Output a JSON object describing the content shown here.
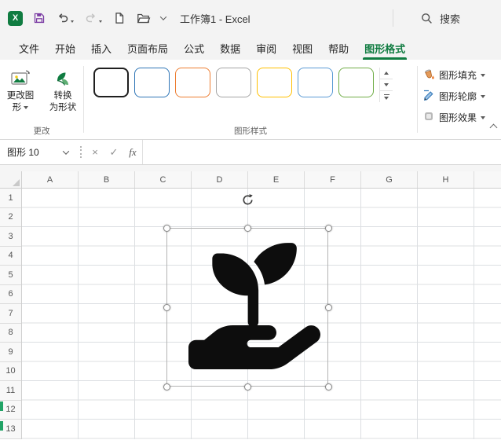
{
  "titlebar": {
    "app_label": "X",
    "title": "工作簿1 - Excel",
    "search_label": "搜索"
  },
  "tabs": [
    "文件",
    "开始",
    "插入",
    "页面布局",
    "公式",
    "数据",
    "审阅",
    "视图",
    "帮助",
    "图形格式"
  ],
  "active_tab": "图形格式",
  "ribbon": {
    "change_group": {
      "label": "更改",
      "change_graphic_line1": "更改图",
      "change_graphic_line2": "形",
      "convert_line1": "转换",
      "convert_line2": "为形状"
    },
    "styles_group": {
      "label": "图形样式",
      "swatches": [
        {
          "border": "#1f1f1f",
          "selected": true
        },
        {
          "border": "#2e75b6",
          "selected": false
        },
        {
          "border": "#ed7d31",
          "selected": false
        },
        {
          "border": "#a5a5a5",
          "selected": false
        },
        {
          "border": "#ffc000",
          "selected": false
        },
        {
          "border": "#5b9bd5",
          "selected": false
        },
        {
          "border": "#70ad47",
          "selected": false
        }
      ]
    },
    "format_group": {
      "fill_label": "图形填充",
      "outline_label": "图形轮廓",
      "effects_label": "图形效果"
    }
  },
  "formula_bar": {
    "name_box": "图形 10",
    "cancel_label": "×",
    "enter_label": "✓",
    "fx_label": "fx",
    "formula_value": ""
  },
  "grid": {
    "columns": [
      "A",
      "B",
      "C",
      "D",
      "E",
      "F",
      "G",
      "H"
    ],
    "rows": [
      "1",
      "2",
      "3",
      "4",
      "5",
      "6",
      "7",
      "8",
      "9",
      "10",
      "11",
      "12",
      "13"
    ]
  },
  "shape": {
    "fill": "#0d0d0d"
  },
  "colors": {
    "accent_green": "#107c41",
    "marker_green": "#21a366"
  }
}
